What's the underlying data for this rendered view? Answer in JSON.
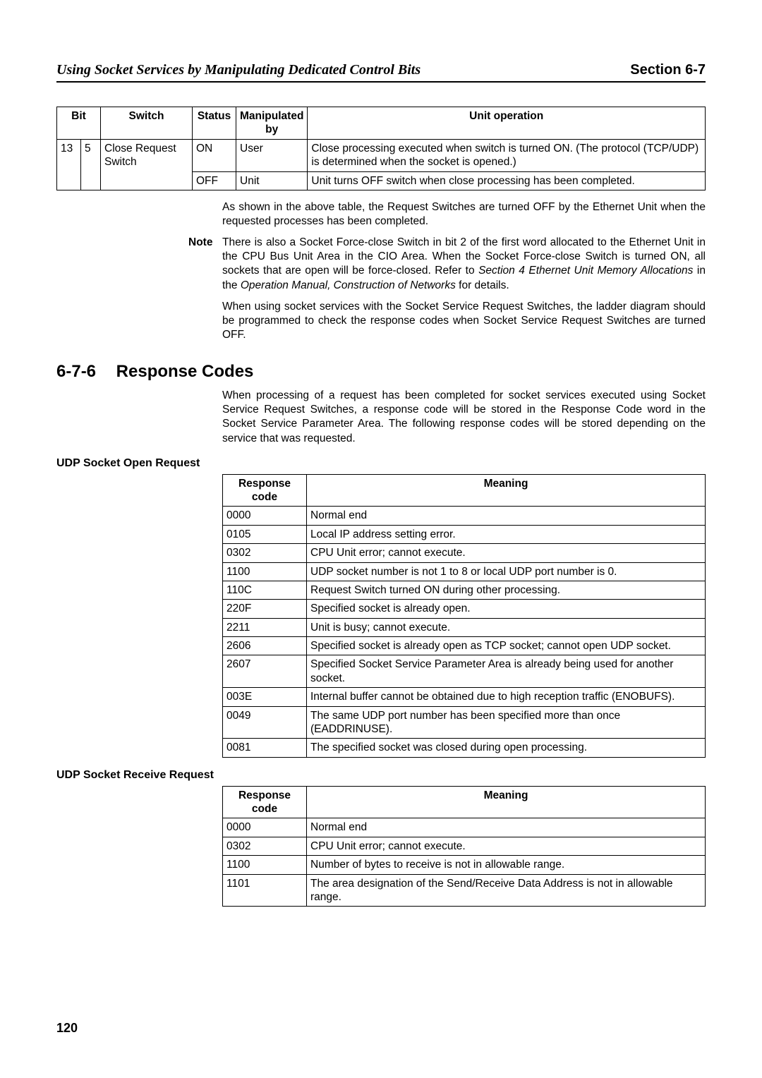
{
  "header": {
    "left": "Using Socket Services by Manipulating Dedicated Control Bits",
    "right": "Section 6-7"
  },
  "table1": {
    "head": {
      "bit": "Bit",
      "switch": "Switch",
      "status": "Status",
      "manip": "Manipulated by",
      "op": "Unit operation"
    },
    "row": {
      "bit1": "13",
      "bit2": "5",
      "switch": "Close Request Switch",
      "on_status": "ON",
      "on_by": "User",
      "on_op": "Close processing executed when switch is turned ON. (The protocol (TCP/UDP) is determined when the socket is opened.)",
      "off_status": "OFF",
      "off_by": "Unit",
      "off_op": "Unit turns OFF switch when close processing has been completed."
    }
  },
  "para1": "As shown in the above table, the Request Switches are turned OFF by the Ethernet Unit when the requested processes has been completed.",
  "note_label": "Note",
  "note_a": "There is also a Socket Force-close Switch in bit 2 of the first word allocated to the Ethernet Unit in the CPU Bus Unit Area in the CIO Area. When the Socket Force-close Switch is turned ON, all sockets that are open will be force-closed. Refer to ",
  "note_ref1": "Section 4 Ethernet Unit Memory Allocations",
  "note_b": " in the ",
  "note_ref2": "Operation Manual, Construction of Networks",
  "note_c": " for details.",
  "para2": "When using socket services with the Socket Service Request Switches, the ladder diagram should be programmed to check the response codes when Socket Service Request Switches are turned OFF.",
  "section": {
    "num": "6-7-6",
    "title": "Response Codes"
  },
  "para3": "When processing of a request has been completed for socket services executed using Socket Service Request Switches, a response code will be stored in the Response Code word in the Socket Service Parameter Area. The following response codes will be stored depending on the service that was requested.",
  "udp_open": {
    "label": "UDP Socket Open Request",
    "head": {
      "code": "Response code",
      "meaning": "Meaning"
    },
    "rows": [
      {
        "c": "0000",
        "m": "Normal end"
      },
      {
        "c": "0105",
        "m": "Local IP address setting error."
      },
      {
        "c": "0302",
        "m": "CPU Unit error; cannot execute."
      },
      {
        "c": "1100",
        "m": "UDP socket number is not 1 to 8 or local UDP port number is 0."
      },
      {
        "c": "110C",
        "m": "Request Switch turned ON during other processing."
      },
      {
        "c": "220F",
        "m": "Specified socket is already open."
      },
      {
        "c": "2211",
        "m": "Unit is busy; cannot execute."
      },
      {
        "c": "2606",
        "m": "Specified socket is already open as TCP socket; cannot open UDP socket."
      },
      {
        "c": "2607",
        "m": "Specified Socket Service Parameter Area is already being used for another socket."
      },
      {
        "c": "003E",
        "m": "Internal buffer cannot be obtained due to high reception traffic (ENOBUFS)."
      },
      {
        "c": "0049",
        "m": "The same UDP port number has been specified more than once (EADDRINUSE)."
      },
      {
        "c": "0081",
        "m": "The specified socket was closed during open processing."
      }
    ]
  },
  "udp_recv": {
    "label": "UDP Socket Receive Request",
    "head": {
      "code": "Response code",
      "meaning": "Meaning"
    },
    "rows": [
      {
        "c": "0000",
        "m": "Normal end"
      },
      {
        "c": "0302",
        "m": "CPU Unit error; cannot execute."
      },
      {
        "c": "1100",
        "m": "Number of bytes to receive is not in allowable range."
      },
      {
        "c": "1101",
        "m": "The area designation of the Send/Receive Data Address is not in allowable range."
      }
    ]
  },
  "page_number": "120"
}
